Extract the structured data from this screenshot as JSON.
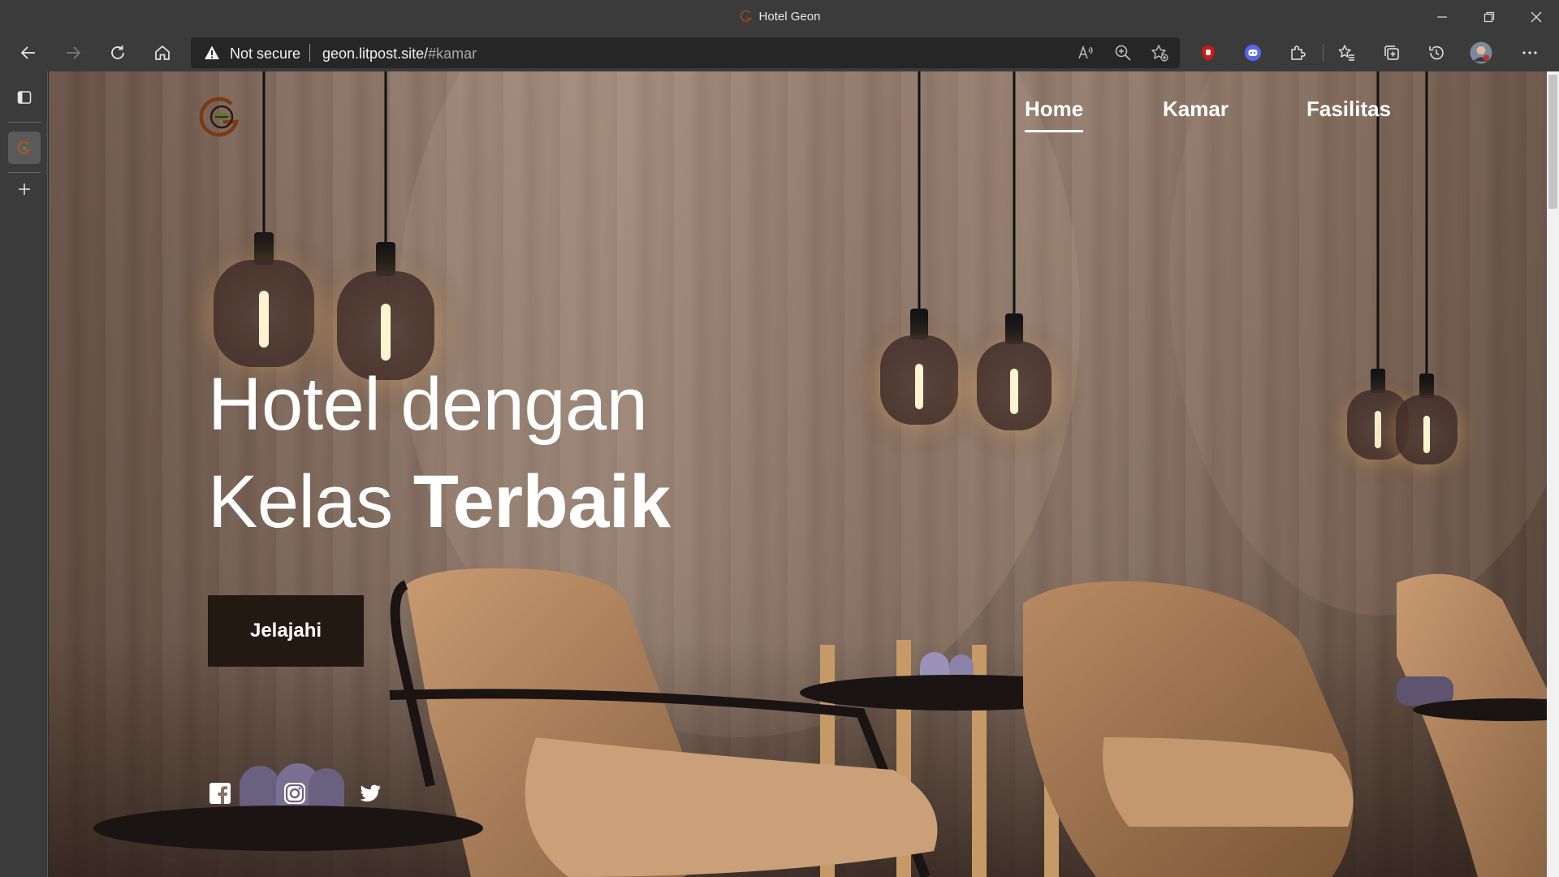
{
  "window": {
    "title": "Hotel Geon",
    "controls": {
      "minimize": "minimize-icon",
      "restore": "restore-icon",
      "close": "close-icon"
    }
  },
  "toolbar": {
    "security_label": "Not secure",
    "url_host": "geon.litpost.site/",
    "url_fragment": "#kamar",
    "icons": [
      "back-icon",
      "forward-icon",
      "refresh-icon",
      "home-icon",
      "read-aloud-icon",
      "zoom-icon",
      "add-favorite-icon",
      "ublock-icon",
      "discord-extension-icon",
      "extensions-icon",
      "favorites-icon",
      "collections-icon",
      "history-icon",
      "profile-avatar",
      "more-icon"
    ]
  },
  "sidebar": {
    "icons": [
      "tab-actions-icon",
      "hotel-geon-tab",
      "new-tab-icon"
    ]
  },
  "site": {
    "nav": [
      {
        "label": "Home",
        "active": true
      },
      {
        "label": "Kamar",
        "active": false
      },
      {
        "label": "Fasilitas",
        "active": false
      }
    ],
    "hero": {
      "line1": "Hotel dengan",
      "line2_regular": "Kelas ",
      "line2_bold": "Terbaik"
    },
    "cta_label": "Jelajahi",
    "social": [
      "facebook-icon",
      "instagram-icon",
      "twitter-icon"
    ]
  },
  "colors": {
    "browser_chrome": "#3b3b3b",
    "address_bar": "#262626",
    "cta_background": "#231812",
    "logo_ring": "#7a3a14",
    "logo_leaf": "#5a7a2a"
  }
}
